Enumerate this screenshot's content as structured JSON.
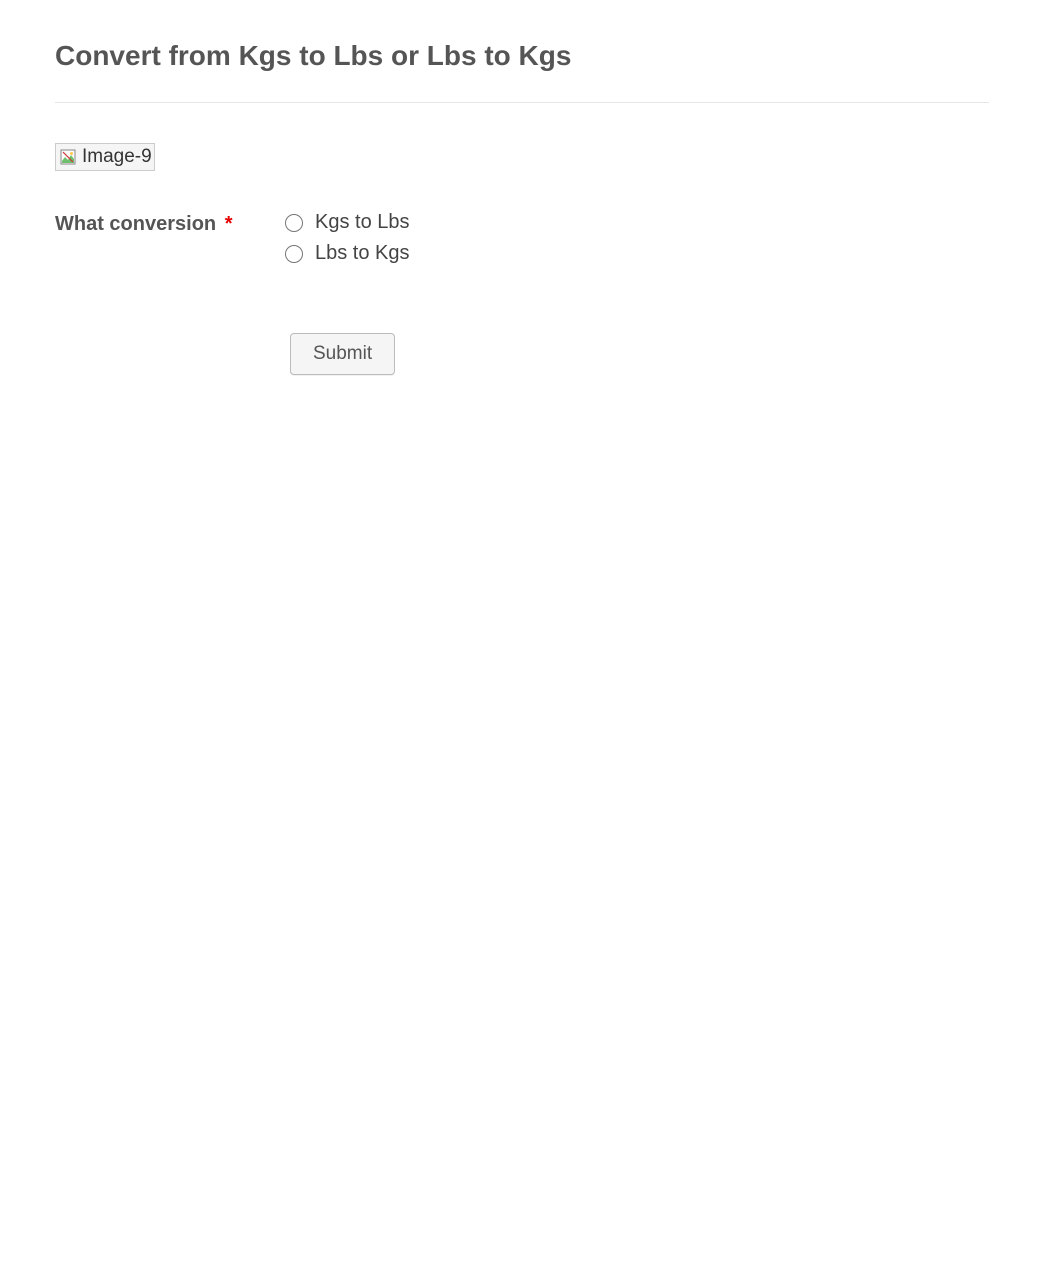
{
  "page": {
    "title": "Convert from Kgs to Lbs or Lbs to Kgs"
  },
  "image": {
    "alt": "Image-9"
  },
  "form": {
    "question_label": "What conversion",
    "required_marker": "*",
    "options": [
      "Kgs to Lbs",
      "Lbs to Kgs"
    ],
    "submit_label": "Submit"
  }
}
